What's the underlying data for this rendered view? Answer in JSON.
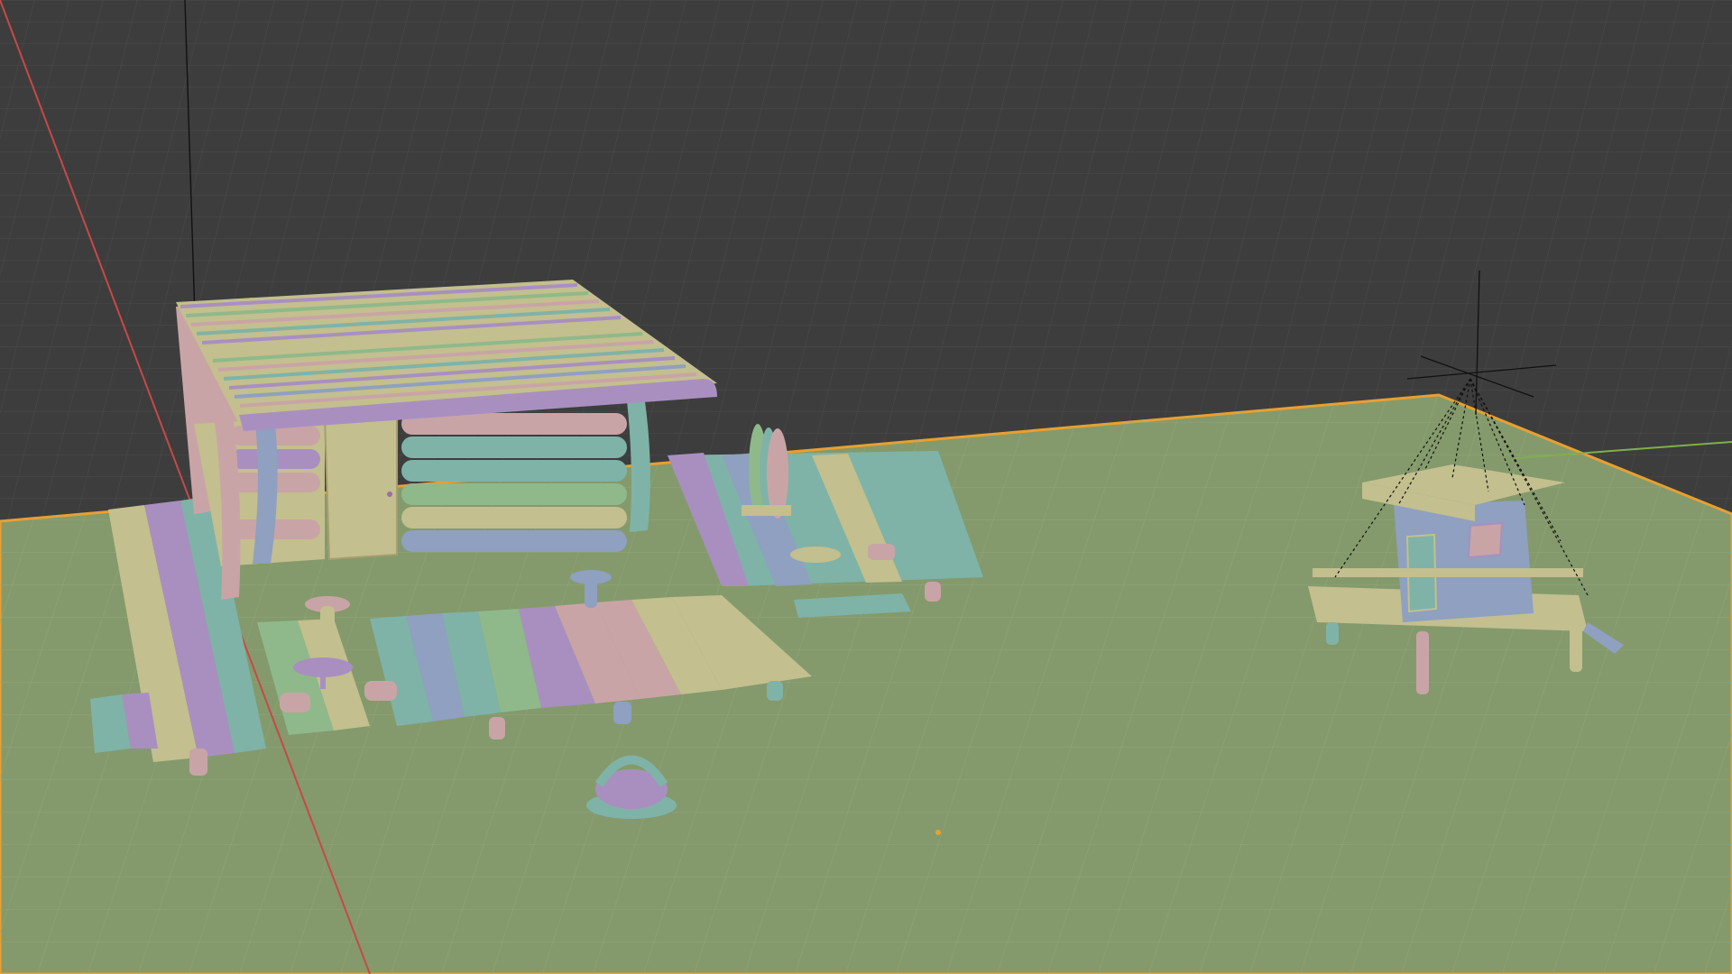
{
  "viewport": {
    "background_color": "#3d3d3d",
    "grid_line_color": "#4a4a4a",
    "ground_plane_color": "#849a6c",
    "selection_outline_color": "#e8a030",
    "x_axis_color": "#c84848",
    "y_axis_color": "#7fb04a",
    "vertex_paint_colors": [
      "#a98fc0",
      "#7fb3a8",
      "#c9a4a6",
      "#c3bf8e",
      "#8fb98a",
      "#8fa0c0"
    ]
  },
  "objects": [
    {
      "name_icon": "log-cabin-mesh",
      "kind": "mesh"
    },
    {
      "name_icon": "wooden-deck-mesh",
      "kind": "mesh"
    },
    {
      "name_icon": "surfboard-rack-mesh",
      "kind": "mesh"
    },
    {
      "name_icon": "fire-pit-mesh",
      "kind": "mesh"
    },
    {
      "name_icon": "lifeguard-tower-mesh",
      "kind": "mesh"
    },
    {
      "name_icon": "light-empty",
      "kind": "empty"
    }
  ]
}
